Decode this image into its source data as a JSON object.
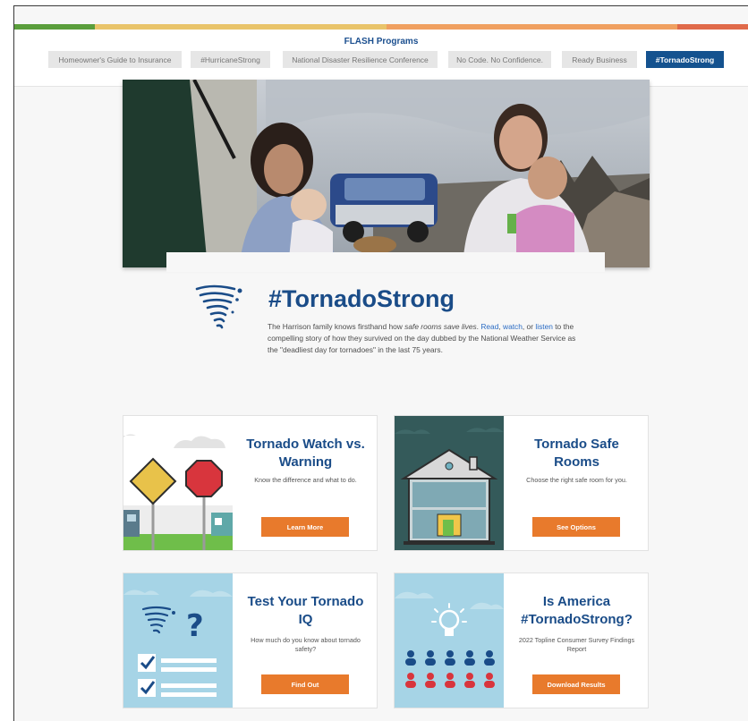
{
  "colors": {
    "green": "#5a9e3c",
    "yellow": "#e9c46a",
    "orange": "#f0a060",
    "red": "#e06a4a",
    "navy": "#1a4c88",
    "accent": "#e87a2c",
    "link": "#2b6cc4"
  },
  "header": {
    "title": "FLASH Programs",
    "nav": [
      {
        "label": "Homeowner's Guide to Insurance",
        "active": false
      },
      {
        "label": "#HurricaneStrong",
        "active": false
      },
      {
        "label": "National Disaster Resilience Conference",
        "active": false
      },
      {
        "label": "No Code. No Confidence.",
        "active": false
      },
      {
        "label": "Ready Business",
        "active": false
      },
      {
        "label": "#TornadoStrong",
        "active": true
      }
    ]
  },
  "intro": {
    "icon": "tornado-icon",
    "title": "#TornadoStrong",
    "text_1": "The Harrison family knows firsthand how ",
    "text_em": "safe rooms save lives",
    "text_2": ". ",
    "link_read": "Read",
    "text_3": ", ",
    "link_watch": "watch",
    "text_4": ", or ",
    "link_listen": "listen",
    "text_5": " to the compelling story of how they survived on the day dubbed by the National Weather Service as the \"deadliest day for tornadoes\" in the last 75 years."
  },
  "cards": [
    {
      "title": "Tornado Watch vs. Warning",
      "desc": "Know the difference and what to do.",
      "button": "Learn More",
      "icon": "road-signs-icon"
    },
    {
      "title": "Tornado Safe Rooms",
      "desc": "Choose the right safe room for you.",
      "button": "See Options",
      "icon": "house-cutaway-icon"
    },
    {
      "title": "Test Your Tornado IQ",
      "desc": "How much do you know about tornado safety?",
      "button": "Find Out",
      "icon": "quiz-checklist-icon"
    },
    {
      "title": "Is America #TornadoStrong?",
      "desc": "2022 Topline Consumer Survey Findings Report",
      "button": "Download Results",
      "icon": "lightbulb-people-icon"
    }
  ]
}
